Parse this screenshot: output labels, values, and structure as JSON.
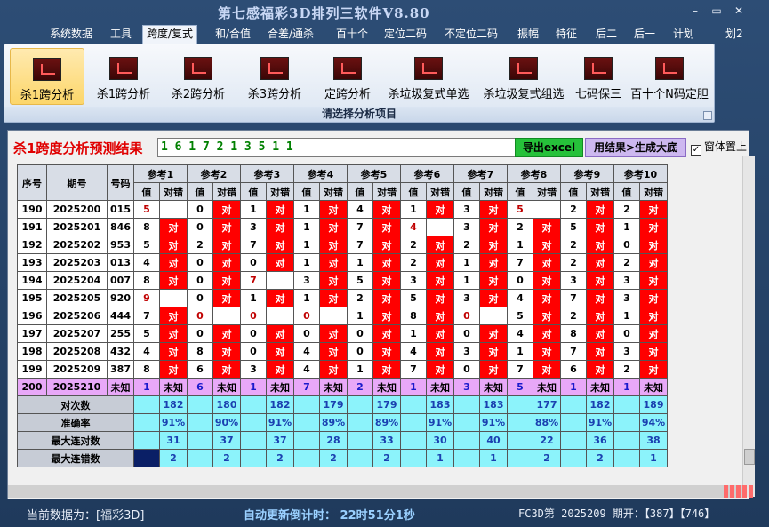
{
  "app": {
    "title": "第七感福彩3D排列三软件V8.80",
    "controls": {
      "minimize": "–",
      "restore": "▭",
      "close": "✕"
    }
  },
  "menu": [
    "系统数据",
    "工具",
    "跨度/复式",
    "和/合值",
    "合差/通杀",
    "百十个",
    "定位二码",
    "不定位二码",
    "振幅",
    "特征",
    "后二",
    "后一",
    "计划",
    "划2"
  ],
  "menu_active_index": 2,
  "ribbon": {
    "buttons": [
      "杀1跨分析",
      "杀1跨分析",
      "杀2跨分析",
      "杀3跨分析",
      "定跨分析",
      "杀垃圾复式单选",
      "杀垃圾复式组选",
      "七码保三",
      "百十个N码定胆"
    ],
    "selected_index": 0,
    "group_label": "请选择分析项目"
  },
  "result": {
    "title": "杀1跨度分析预测结果",
    "value": "1 6 1 7 2 1 3 5 1 1",
    "export_label": "导出excel",
    "generate_label": "用结果>生成大底",
    "topmost_label": "窗体置上",
    "topmost_checked": "✓"
  },
  "table": {
    "headers": {
      "idx": "序号",
      "issue": "期号",
      "code": "号码",
      "value": "值",
      "result": "对错"
    },
    "refs": [
      "参考1",
      "参考2",
      "参考3",
      "参考4",
      "参考5",
      "参考6",
      "参考7",
      "参考8",
      "参考9",
      "参考10"
    ],
    "hit_label": "对",
    "unknown_label": "未知",
    "rows": [
      {
        "idx": "190",
        "issue": "2025200",
        "code": "015",
        "v": [
          "5",
          "0",
          "1",
          "1",
          "4",
          "1",
          "3",
          "5",
          "2",
          "2"
        ],
        "r": [
          0,
          1,
          1,
          1,
          1,
          1,
          1,
          0,
          1,
          1
        ]
      },
      {
        "idx": "191",
        "issue": "2025201",
        "code": "846",
        "v": [
          "8",
          "0",
          "3",
          "1",
          "7",
          "4",
          "3",
          "2",
          "5",
          "1"
        ],
        "r": [
          1,
          1,
          1,
          1,
          1,
          0,
          1,
          1,
          1,
          1
        ]
      },
      {
        "idx": "192",
        "issue": "2025202",
        "code": "953",
        "v": [
          "5",
          "2",
          "7",
          "1",
          "7",
          "2",
          "2",
          "1",
          "2",
          "0"
        ],
        "r": [
          1,
          1,
          1,
          1,
          1,
          1,
          1,
          1,
          1,
          1
        ]
      },
      {
        "idx": "193",
        "issue": "2025203",
        "code": "013",
        "v": [
          "4",
          "0",
          "0",
          "1",
          "1",
          "2",
          "1",
          "7",
          "2",
          "2"
        ],
        "r": [
          1,
          1,
          1,
          1,
          1,
          1,
          1,
          1,
          1,
          1
        ]
      },
      {
        "idx": "194",
        "issue": "2025204",
        "code": "007",
        "v": [
          "8",
          "0",
          "7",
          "3",
          "5",
          "3",
          "1",
          "0",
          "3",
          "3"
        ],
        "r": [
          1,
          1,
          0,
          1,
          1,
          1,
          1,
          1,
          1,
          1
        ]
      },
      {
        "idx": "195",
        "issue": "2025205",
        "code": "920",
        "v": [
          "9",
          "0",
          "1",
          "1",
          "2",
          "5",
          "3",
          "4",
          "7",
          "3"
        ],
        "r": [
          0,
          1,
          1,
          1,
          1,
          1,
          1,
          1,
          1,
          1
        ]
      },
      {
        "idx": "196",
        "issue": "2025206",
        "code": "444",
        "v": [
          "7",
          "0",
          "0",
          "0",
          "1",
          "8",
          "0",
          "5",
          "2",
          "1"
        ],
        "r": [
          1,
          0,
          0,
          0,
          1,
          1,
          0,
          1,
          1,
          1
        ]
      },
      {
        "idx": "197",
        "issue": "2025207",
        "code": "255",
        "v": [
          "5",
          "0",
          "0",
          "0",
          "0",
          "1",
          "0",
          "4",
          "8",
          "0"
        ],
        "r": [
          1,
          1,
          1,
          1,
          1,
          1,
          1,
          1,
          1,
          1
        ]
      },
      {
        "idx": "198",
        "issue": "2025208",
        "code": "432",
        "v": [
          "4",
          "8",
          "0",
          "4",
          "0",
          "4",
          "3",
          "1",
          "7",
          "3"
        ],
        "r": [
          1,
          1,
          1,
          1,
          1,
          1,
          1,
          1,
          1,
          1
        ]
      },
      {
        "idx": "199",
        "issue": "2025209",
        "code": "387",
        "v": [
          "8",
          "6",
          "3",
          "4",
          "1",
          "7",
          "0",
          "7",
          "6",
          "2"
        ],
        "r": [
          1,
          1,
          1,
          1,
          1,
          1,
          1,
          1,
          1,
          1
        ]
      }
    ],
    "pending": {
      "idx": "200",
      "issue": "2025210",
      "code": "未知",
      "v": [
        "1",
        "6",
        "1",
        "7",
        "2",
        "1",
        "3",
        "5",
        "1",
        "1"
      ]
    },
    "stats": [
      {
        "label": "对次数",
        "values": [
          "182",
          "180",
          "182",
          "179",
          "179",
          "183",
          "183",
          "177",
          "182",
          "189"
        ]
      },
      {
        "label": "准确率",
        "values": [
          "91%",
          "90%",
          "91%",
          "89%",
          "89%",
          "91%",
          "91%",
          "88%",
          "91%",
          "94%"
        ]
      },
      {
        "label": "最大连对数",
        "values": [
          "31",
          "37",
          "37",
          "28",
          "33",
          "30",
          "40",
          "22",
          "36",
          "38"
        ]
      },
      {
        "label": "最大连错数",
        "values": [
          "2",
          "2",
          "2",
          "2",
          "2",
          "1",
          "1",
          "2",
          "2",
          "1"
        ]
      }
    ]
  },
  "status": {
    "left": "当前数据为：[福彩3D]",
    "mid": "自动更新倒计时： 22时51分1秒",
    "right": "FC3D第 2025209 期开：【387】【746】"
  }
}
